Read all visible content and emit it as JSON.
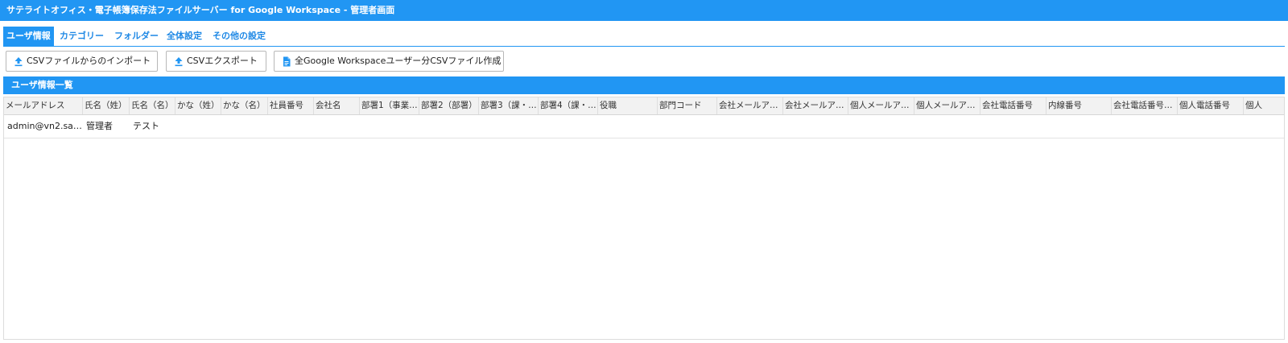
{
  "window": {
    "title": "サテライトオフィス・電子帳簿保存法ファイルサーバー for Google Workspace - 管理者画面"
  },
  "tabs": [
    {
      "label": "ユーザ情報",
      "active": true
    },
    {
      "label": "カテゴリー",
      "active": false
    },
    {
      "label": "フォルダー",
      "active": false
    },
    {
      "label": "全体設定",
      "active": false
    },
    {
      "label": "その他の設定",
      "active": false
    }
  ],
  "toolbar": {
    "import_label": "CSVファイルからのインポート",
    "export_label": "CSVエクスポート",
    "create_label": "全Google Workspaceユーザー分CSVファイル作成",
    "import_icon": "upload-icon",
    "export_icon": "upload-icon",
    "create_icon": "document-icon"
  },
  "section": {
    "title": "ユーザ情報一覧"
  },
  "table": {
    "columns": [
      "メールアドレス",
      "氏名（姓）",
      "氏名（名）",
      "かな（姓）",
      "かな（名）",
      "社員番号",
      "会社名",
      "部署1（事業…",
      "部署2（部署）",
      "部署3（課・…",
      "部署4（課・…",
      "役職",
      "部門コード",
      "会社メールア…",
      "会社メールア…",
      "個人メールア…",
      "個人メールア…",
      "会社電話番号",
      "内線番号",
      "会社電話番号…",
      "個人電話番号",
      "個人"
    ],
    "rows": [
      {
        "email": "admin@vn2.sat…",
        "last_name": "管理者",
        "first_name": "テスト"
      }
    ]
  },
  "colors": {
    "accent": "#2196f3",
    "header_bg": "#f2f2f2",
    "tab_text": "#1e88e5"
  }
}
